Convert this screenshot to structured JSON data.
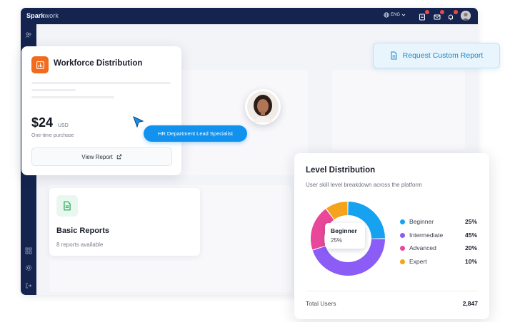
{
  "topbar": {
    "brand_bold": "Spark",
    "brand_light": "work",
    "language": "ENG"
  },
  "icons": {
    "globe": "globe-icon",
    "tasks": "tasks-icon",
    "mail": "mail-icon",
    "bell": "bell-icon",
    "chart": "bar-chart-icon",
    "document": "document-icon",
    "external": "external-link-icon"
  },
  "workforce_card": {
    "title": "Workforce Distribution",
    "price": "$24",
    "currency": "USD",
    "price_note": "One-time purchase",
    "view_label": "View Report"
  },
  "tooltip": {
    "label": "HR Department Lead Specialist"
  },
  "request": {
    "label": "Request Custom Report"
  },
  "basic_reports": {
    "title": "Basic Reports",
    "subtitle": "8 reports available"
  },
  "level_distribution": {
    "title": "Level Distribution",
    "subtitle": "User skill level breakdown across the platform",
    "highlight": {
      "name": "Beginner",
      "value": "25%"
    },
    "legend": [
      {
        "name": "Beginner",
        "value": "25%",
        "percent": 25,
        "color": "#16a2f0"
      },
      {
        "name": "Intermediate",
        "value": "45%",
        "percent": 45,
        "color": "#8b5cf6"
      },
      {
        "name": "Advanced",
        "value": "20%",
        "percent": 20,
        "color": "#e9479a"
      },
      {
        "name": "Expert",
        "value": "10%",
        "percent": 10,
        "color": "#f5a31a"
      }
    ],
    "total_label": "Total Users",
    "total_value": "2,847"
  },
  "colors": {
    "navy": "#15244f",
    "accent": "#1292ef",
    "orange": "#f26a1b",
    "green": "#16a34a"
  }
}
